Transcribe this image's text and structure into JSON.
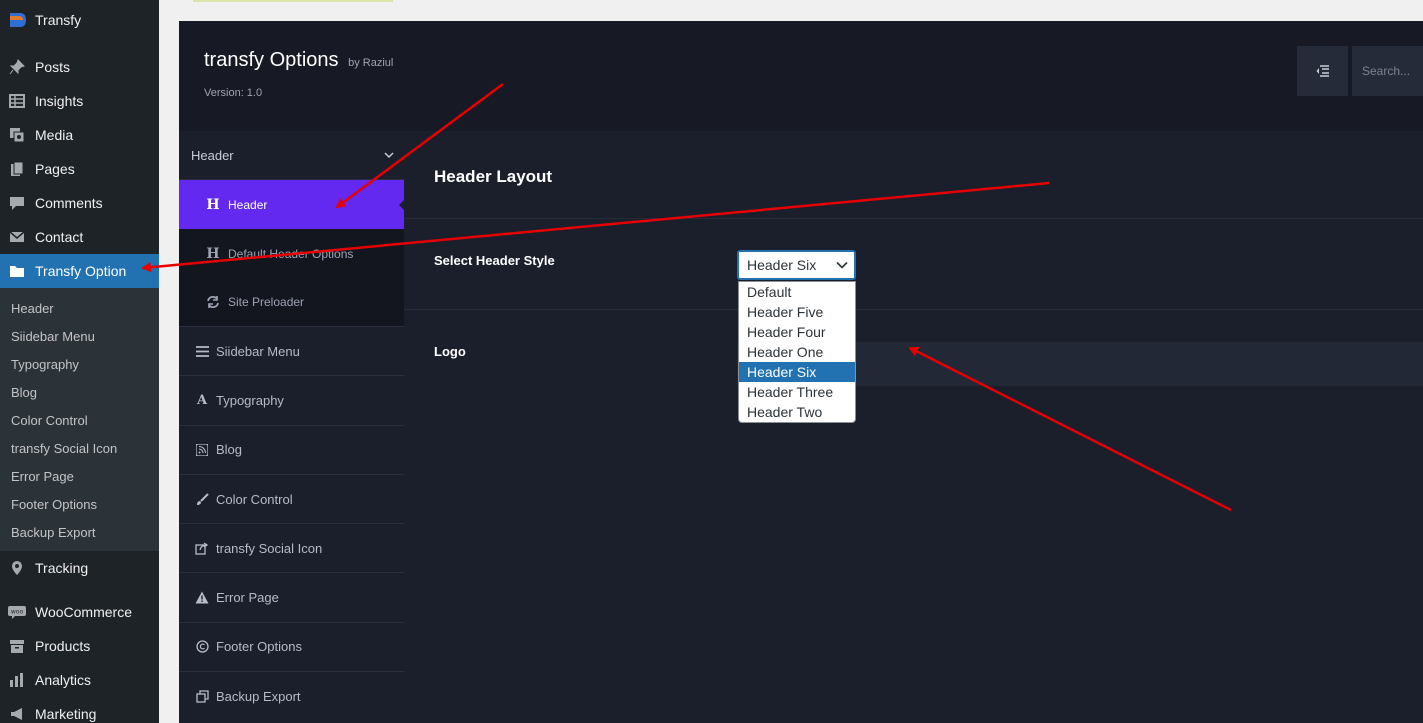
{
  "wp_sidebar": {
    "site_name": "Transfy",
    "menu_top": [
      {
        "label": "Posts",
        "icon": "pin-icon"
      },
      {
        "label": "Insights",
        "icon": "table-icon"
      },
      {
        "label": "Media",
        "icon": "media-icon"
      },
      {
        "label": "Pages",
        "icon": "pages-icon"
      },
      {
        "label": "Comments",
        "icon": "comment-icon"
      },
      {
        "label": "Contact",
        "icon": "mail-icon"
      }
    ],
    "active_item": {
      "label": "Transfy Option",
      "icon": "folder-icon"
    },
    "submenu": [
      "Header",
      "Siidebar Menu",
      "Typography",
      "Blog",
      "Color Control",
      "transfy Social Icon",
      "Error Page",
      "Footer Options",
      "Backup Export"
    ],
    "menu_bottom": [
      {
        "label": "Tracking",
        "icon": "location-icon"
      },
      {
        "label": "WooCommerce",
        "icon": "woo-icon"
      },
      {
        "label": "Products",
        "icon": "archive-icon"
      },
      {
        "label": "Analytics",
        "icon": "chart-icon"
      },
      {
        "label": "Marketing",
        "icon": "megaphone-icon"
      }
    ]
  },
  "panel": {
    "title": "transfy Options",
    "by": "by Raziul",
    "version": "Version: 1.0",
    "search_placeholder": "Search..."
  },
  "opt_nav": {
    "group_label": "Header",
    "sub_items": [
      {
        "label": "Header",
        "icon": "H",
        "active": true
      },
      {
        "label": "Default Header Options",
        "icon": "H",
        "active": false
      },
      {
        "label": "Site Preloader",
        "icon": "refresh-icon",
        "active": false
      }
    ],
    "items": [
      {
        "label": "Siidebar Menu",
        "icon": "bars-icon"
      },
      {
        "label": "Typography",
        "icon": "font-icon"
      },
      {
        "label": "Blog",
        "icon": "rss-icon"
      },
      {
        "label": "Color Control",
        "icon": "brush-icon"
      },
      {
        "label": "transfy Social Icon",
        "icon": "share-icon"
      },
      {
        "label": "Error Page",
        "icon": "warning-icon"
      },
      {
        "label": "Footer Options",
        "icon": "copyright-icon"
      },
      {
        "label": "Backup Export",
        "icon": "clone-icon"
      }
    ]
  },
  "content": {
    "section_title": "Header Layout",
    "header_style_label": "Select Header Style",
    "header_style_value": "Header Six",
    "header_style_options": [
      "Default",
      "Header Five",
      "Header Four",
      "Header One",
      "Header Six",
      "Header Three",
      "Header Two"
    ],
    "logo_label": "Logo"
  },
  "colors": {
    "wp_sidebar_bg": "#1d2327",
    "wp_active": "#2271b1",
    "panel_bg": "#1b1f2c",
    "nav_active": "#6429f0",
    "arrow": "#e60000"
  }
}
